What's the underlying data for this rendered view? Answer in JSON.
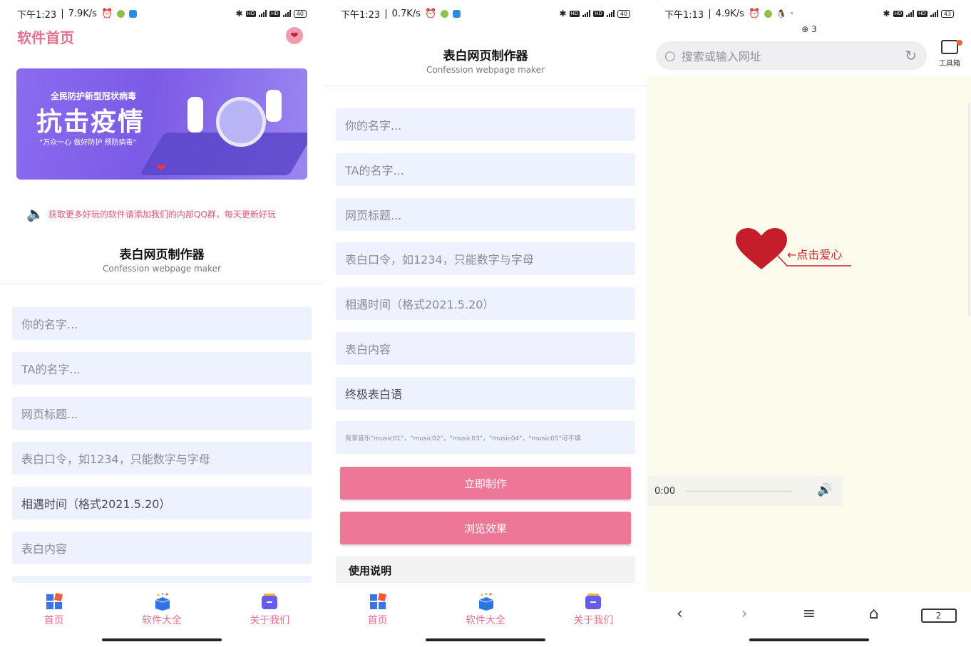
{
  "panel1": {
    "status": {
      "time": "下午1:23",
      "speed": "7.9K/s",
      "battery": "40"
    },
    "app_title": "软件首页",
    "banner": {
      "line1": "全民防护新型冠状病毒",
      "line2": "抗击疫情",
      "line3": "“万众一心  做好防护  预防病毒”"
    },
    "notice": "获取更多好玩的软件请添加我们的内部QQ群，每天更新好玩",
    "form_title": "表白网页制作器",
    "form_subtitle": "Confession webpage maker",
    "fields": [
      "你的名字...",
      "TA的名字...",
      "网页标题...",
      "表白口令，如1234，只能数字与字母",
      "相遇时间（格式2021.5.20）",
      "表白内容"
    ],
    "tabs": [
      "首页",
      "软件大全",
      "关于我们"
    ]
  },
  "panel2": {
    "status": {
      "time": "下午1:23",
      "speed": "0.7K/s",
      "battery": "40"
    },
    "form_title": "表白网页制作器",
    "form_subtitle": "Confession webpage maker",
    "fields": [
      "你的名字...",
      "TA的名字...",
      "网页标题...",
      "表白口令，如1234，只能数字与字母",
      "相遇时间（格式2021.5.20）",
      "表白内容",
      "终极表白语",
      "背景音乐\"music01\"，\"music02\"，\"music03\"，\"music04\"，\"music05\"可不填"
    ],
    "make_button": "立即制作",
    "preview_button": "浏览效果",
    "usage_title": "使用说明",
    "tabs": [
      "首页",
      "软件大全",
      "关于我们"
    ]
  },
  "panel3": {
    "status": {
      "time": "下午1:13",
      "speed": "4.9K/s",
      "battery": "43"
    },
    "tab_count_top": "3",
    "search_placeholder": "搜索或输入网址",
    "toolbox_label": "工具箱",
    "heart_hint": "←点击爱心",
    "audio_time": "0:00",
    "tab_count": "2"
  },
  "colors": {
    "accent": "#e8708f",
    "button": "#ee7696",
    "field_bg": "#eef1fe",
    "page_bg": "#fdfcec",
    "heart": "#c41e2a"
  }
}
